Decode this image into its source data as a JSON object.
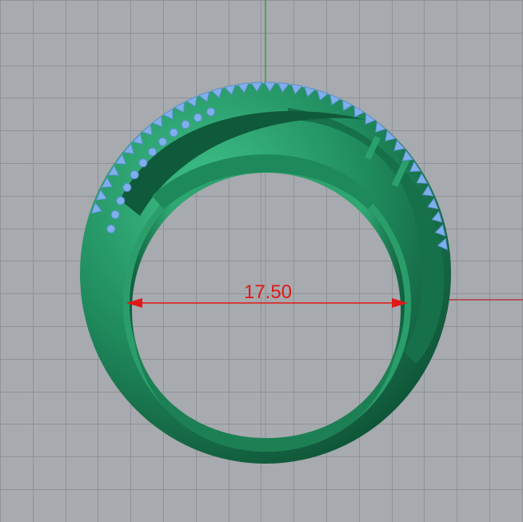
{
  "viewport": {
    "background": "#a7aaae",
    "grid_color": "#8f9296",
    "x_axis_color": "#b33a3a",
    "y_axis_color": "#3a9a3a"
  },
  "model": {
    "metal_color": "#1f8a5c",
    "metal_dark": "#0d4d33",
    "metal_light": "#3fc28a",
    "gem_color": "#7fb0ea"
  },
  "dimension": {
    "value": "17.50",
    "color": "#e01818"
  }
}
